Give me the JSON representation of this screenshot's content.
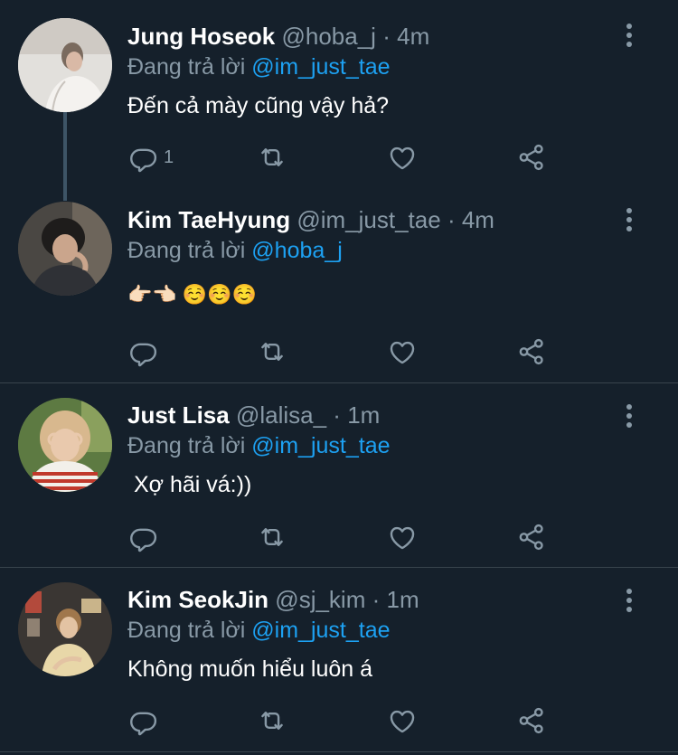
{
  "colors": {
    "background": "#15202b",
    "separator": "#38444d",
    "muted": "#8899a6",
    "link": "#1da1f2"
  },
  "reply_prefix": "Đang trả lời",
  "tweets": [
    {
      "name": "Jung Hoseok",
      "handle": "@hoba_j",
      "time": "4m",
      "reply_to": "@im_just_tae",
      "text": "Đến cả mày cũng vậy hả?",
      "reply_count": "1"
    },
    {
      "name": "Kim TaeHyung",
      "handle": "@im_just_tae",
      "time": "4m",
      "reply_to": "@hoba_j",
      "text": "👉🏻👈🏻 ☺️☺️☺️",
      "reply_count": ""
    },
    {
      "name": "Just Lisa",
      "handle": "@lalisa_",
      "time": "1m",
      "reply_to": "@im_just_tae",
      "text": " Xợ hãi vá:))",
      "reply_count": ""
    },
    {
      "name": "Kim SeokJin",
      "handle": "@sj_kim",
      "time": "1m",
      "reply_to": "@im_just_tae",
      "text": "Không muốn hiểu luôn á",
      "reply_count": ""
    }
  ]
}
